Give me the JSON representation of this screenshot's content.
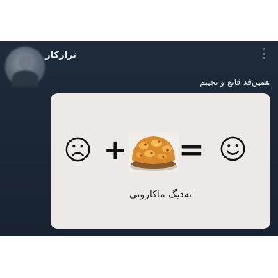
{
  "tweet": {
    "username": "ترازکار",
    "text": "همین‌قد قانع و نجیبم",
    "media": {
      "caption": "تەدیگ ماکارونی",
      "plus_symbol": "+",
      "equals_symbol": "=",
      "left_face": "sad-face",
      "right_face": "happy-face",
      "food": "tahdig-macaroni"
    }
  },
  "colors": {
    "tweet_bg": "#1f2b3a",
    "media_bg": "#ede9e6",
    "text": "#e8edf2"
  }
}
